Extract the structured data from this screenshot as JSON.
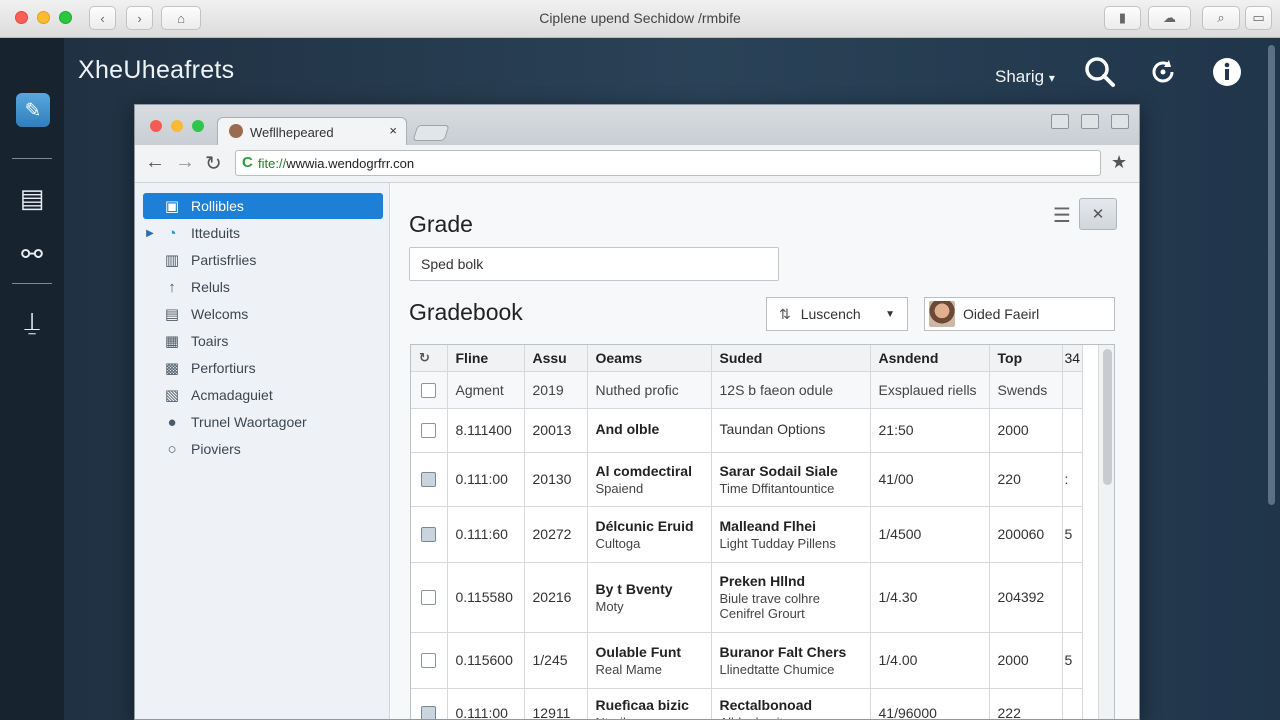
{
  "os": {
    "title": "Ciplene upend Sechidow /rmbife"
  },
  "app": {
    "title": "XheUheafrets",
    "share_label": "Sharig",
    "share_caret": "▾"
  },
  "browser": {
    "tab_title": "Wefllhepeared",
    "tab_close": "×",
    "url_scheme": "fite://",
    "url_host": "wwwia.wendogrfrr.con"
  },
  "sidebar": {
    "items": [
      {
        "label": "Rollibles",
        "icon": "document-icon",
        "active": true
      },
      {
        "label": "Itteduits",
        "icon": "clock-icon"
      },
      {
        "label": "Partisfrlies",
        "icon": "chart-icon"
      },
      {
        "label": "Reluls",
        "icon": "arrow-up-icon"
      },
      {
        "label": "Welcoms",
        "icon": "list-icon"
      },
      {
        "label": "Toairs",
        "icon": "grid-icon"
      },
      {
        "label": "Perfortiurs",
        "icon": "folder-icon"
      },
      {
        "label": "Acmadaguiet",
        "icon": "calendar-icon"
      },
      {
        "label": "Trunel Waortagoer",
        "icon": "pin-icon"
      },
      {
        "label": "Pioviers",
        "icon": "location-icon"
      }
    ]
  },
  "main": {
    "heading": "Grade",
    "search_value": "Sped bolk",
    "subheading": "Gradebook",
    "dropdown_label": "Luscench",
    "user_label": "Oided Faeirl"
  },
  "table": {
    "headers": [
      "",
      "Fline",
      "Assu",
      "Oeams",
      "Suded",
      "Asndend",
      "Top",
      "34"
    ],
    "sub_row": [
      "Agment",
      "2019",
      "Nuthed profic",
      "12S b faeon odule",
      "Exsplaued riells",
      "Swends"
    ],
    "rows": [
      {
        "checked": false,
        "fline": "8.111400",
        "assu": "20013",
        "oeams1": "And olble",
        "oeams2": "",
        "suded1": "Taundan Options",
        "suded2": "",
        "suded3": "",
        "asndend": "21:50",
        "top": "2000",
        "extra": ""
      },
      {
        "checked": true,
        "fline": "0.111:00",
        "assu": "20130",
        "oeams1": "Al comdectiral",
        "oeams2": "Spaiend",
        "suded1": "Sarar Sodail Siale",
        "suded2": "Time Dffitantountice",
        "suded3": "",
        "asndend": "41/00",
        "top": "220",
        "extra": ":"
      },
      {
        "checked": true,
        "fline": "0.111:60",
        "assu": "20272",
        "oeams1": "Délcunic Eruid",
        "oeams2": "Cultoga",
        "suded1": "Malleand Flhei",
        "suded2": "Light Tudday Pillens",
        "suded3": "",
        "asndend": "1/4500",
        "top": "200060",
        "extra": "5"
      },
      {
        "checked": false,
        "fline": "0.115580",
        "assu": "20216",
        "oeams1": "By t Bventy",
        "oeams2": "Moty",
        "suded1": "Preken Hllnd",
        "suded2": "Biule trave colhre",
        "suded3": "Cenifrel Grourt",
        "asndend": "1/4.30",
        "top": "204392",
        "extra": ""
      },
      {
        "checked": false,
        "fline": "0.115600",
        "assu": "1/245",
        "oeams1": "Oulable Funt",
        "oeams2": "Real Mame",
        "suded1": "Buranor Falt Chers",
        "suded2": "Llinedtatte Chumice",
        "suded3": "",
        "asndend": "1/4.00",
        "top": "2000",
        "extra": "5"
      },
      {
        "checked": true,
        "fline": "0.111:00",
        "assu": "12911",
        "oeams1": "Ruefìcaa bizic",
        "oeams2": "Nteril",
        "suded1": "Rectalbonoad",
        "suded2": "Alldaubsoitem",
        "suded3": "",
        "asndend": "41/96000",
        "top": "222",
        "extra": ""
      }
    ]
  }
}
